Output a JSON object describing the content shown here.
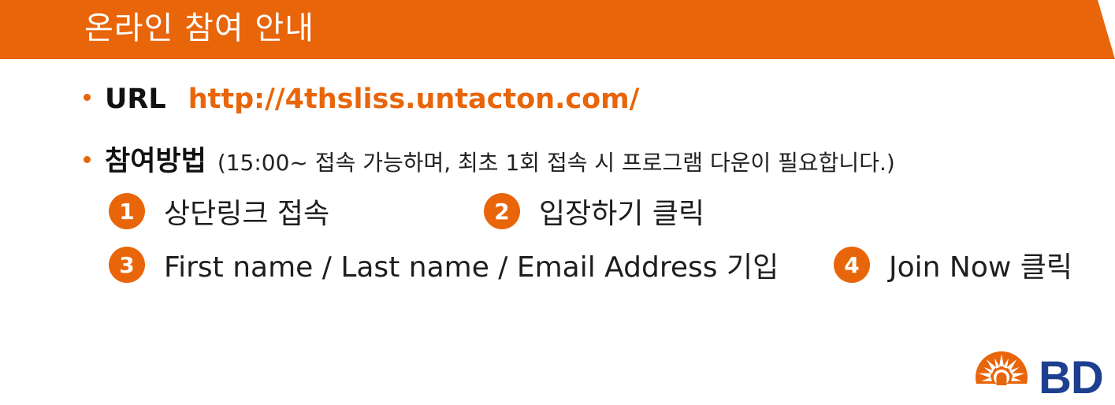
{
  "header": {
    "title": "온라인 참여 안내"
  },
  "url_row": {
    "label": "URL",
    "link": "http://4thsliss.untacton.com/"
  },
  "method_row": {
    "label": "참여방법",
    "note": "(15:00~ 접속 가능하며, 최초 1회 접속 시 프로그램 다운이 필요합니다.)"
  },
  "steps": [
    {
      "num": "1",
      "text": "상단링크 접속"
    },
    {
      "num": "2",
      "text": "입장하기 클릭"
    },
    {
      "num": "3",
      "text": "First name / Last name / Email Address 기입"
    },
    {
      "num": "4",
      "text": "Join Now 클릭"
    }
  ],
  "logo": {
    "text": "BD",
    "icon": "bd-sunburst-icon"
  },
  "colors": {
    "accent": "#e8650a",
    "brand_blue": "#1d3f8f"
  }
}
